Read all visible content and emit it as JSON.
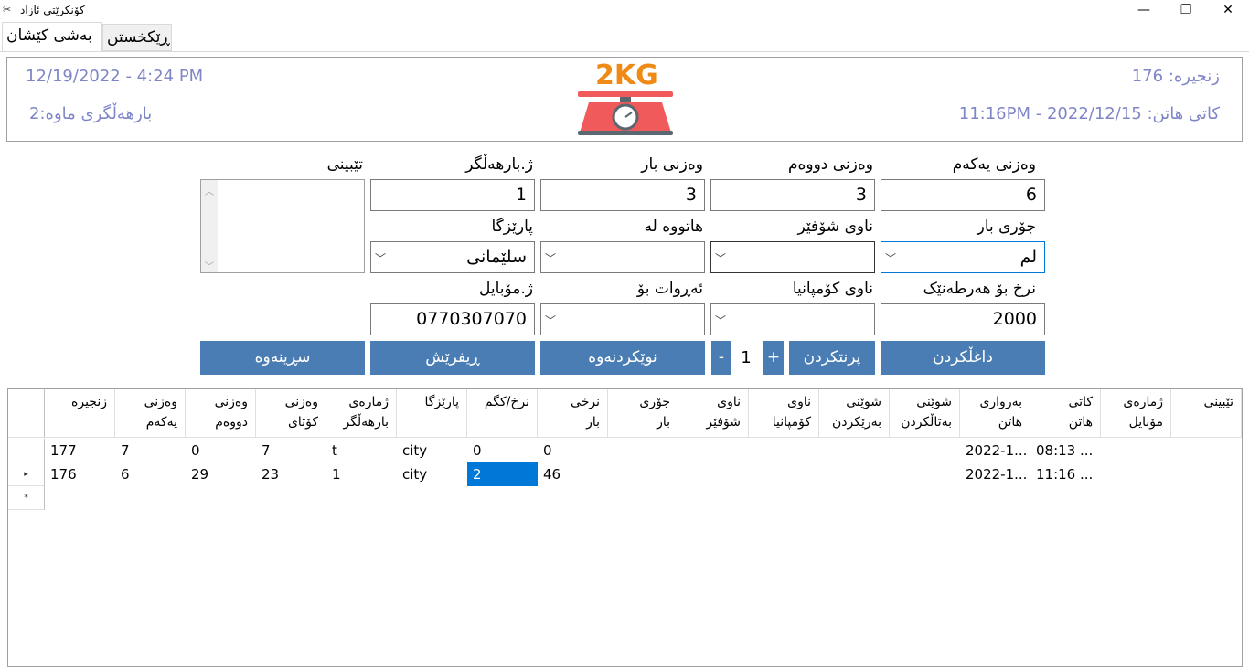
{
  "window": {
    "title": "کۆنکرێتی ئازاد",
    "icon": "app-icon"
  },
  "tabs": [
    {
      "label": "بەشی کێشان"
    },
    {
      "label": "ڕێکخستن"
    }
  ],
  "header": {
    "datetime": "12/19/2022 - 4:24 PM",
    "remaining": "بارهەڵگری ماوە:2",
    "serial": "زنجیرە: 176",
    "arrival": "کاتی هاتن: 2022/12/15 - 11:16PM",
    "scale_text": "2KG",
    "scale_icon": "scale-icon"
  },
  "form": {
    "first_weight": {
      "label": "وەزنی یەکەم",
      "value": "6"
    },
    "second_weight": {
      "label": "وەزنی دووەم",
      "value": "3"
    },
    "load_weight": {
      "label": "وەزنی بار",
      "value": "3"
    },
    "truck_no": {
      "label": "ژ.بارهەڵگر",
      "value": "1"
    },
    "notes": {
      "label": "تێبینی"
    },
    "load_type": {
      "label": "جۆری بار",
      "value": "لم"
    },
    "driver_name": {
      "label": "ناوی شۆفێر",
      "value": ""
    },
    "came_from": {
      "label": "هاتووە لە",
      "value": ""
    },
    "province": {
      "label": "پارێزگا",
      "value": "سلێمانی"
    },
    "price_per_unit": {
      "label": "نرخ بۆ هەرطەنێک",
      "value": "2000"
    },
    "company_name": {
      "label": "ناوی کۆمپانیا",
      "value": ""
    },
    "sent_to": {
      "label": "ئەڕوات بۆ",
      "value": ""
    },
    "mobile": {
      "label": "ژ.مۆبایل",
      "value": "0770307070"
    }
  },
  "buttons": {
    "enter": "داغڵکردن",
    "print": "پرنتکردن",
    "plus": "+",
    "counter": "1",
    "minus": "-",
    "refresh": "نوێکردنەوە",
    "edit": "ڕیفرێش",
    "delete": "سڕینەوە"
  },
  "grid": {
    "columns": [
      "زنجیرە",
      "وەزنی\nیەکەم",
      "وەزنی\nدووەم",
      "وەزنی\nکۆتای",
      "ژمارەی\nبارهەڵگر",
      "پارێزگا",
      "نرخ/کگم",
      "نرخی\nبار",
      "جۆری\nبار",
      "ناوی\nشۆفێر",
      "ناوی\nکۆمپانیا",
      "شوێنی\nبەرێکردن",
      "شوێنی\nبەتاڵکردن",
      "بەرواری\nهاتن",
      "کاتی\nهاتن",
      "ژمارەی\nمۆبایل",
      "تێبینی"
    ],
    "rows": [
      {
        "marker": "",
        "cells": [
          "177",
          "7",
          "0",
          "7",
          "t",
          "city",
          "0",
          "0",
          "",
          "",
          "",
          "",
          "",
          "2022-1...",
          "08:13 ...",
          "",
          ""
        ]
      },
      {
        "marker": "▸",
        "cells": [
          "176",
          "6",
          "29",
          "23",
          "1",
          "city",
          "2",
          "46",
          "",
          "",
          "",
          "",
          "",
          "2022-1...",
          "11:16 ...",
          "",
          ""
        ]
      },
      {
        "marker": "*",
        "cells": [
          "",
          "",
          "",
          "",
          "",
          "",
          "",
          "",
          "",
          "",
          "",
          "",
          "",
          "",
          "",
          "",
          ""
        ]
      }
    ]
  }
}
